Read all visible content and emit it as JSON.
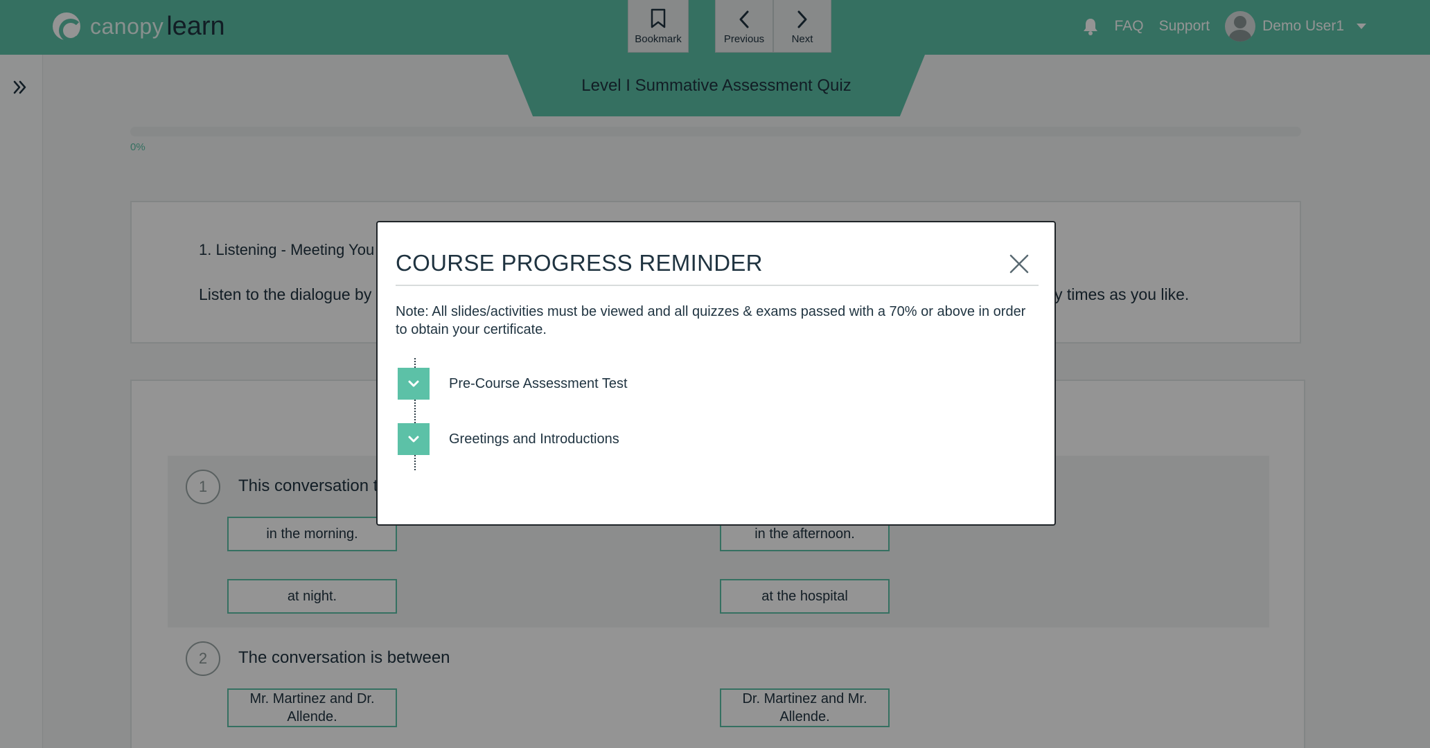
{
  "brand": {
    "word1": "canopy",
    "word2": "learn"
  },
  "toolbar": {
    "bookmark": "Bookmark",
    "previous": "Previous",
    "next": "Next"
  },
  "topnav": {
    "faq": "FAQ",
    "support": "Support",
    "user": "Demo User1"
  },
  "quiz": {
    "title": "Level I Summative Assessment Quiz",
    "progress_label": "0%",
    "progress": 0
  },
  "intro": {
    "title": "1. Listening - Meeting You",
    "text_left": "Listen to the dialogue by p",
    "text_right": "y times as you like."
  },
  "questions": [
    {
      "number": "1",
      "text": "This conversation ta",
      "options": [
        "in the morning.",
        "in the afternoon.",
        "at night.",
        "at the hospital"
      ]
    },
    {
      "number": "2",
      "text": "The conversation is between",
      "options": [
        "Mr. Martinez and Dr. Allende.",
        "Dr. Martinez and Mr. Allende."
      ]
    }
  ],
  "modal": {
    "title": "COURSE PROGRESS REMINDER",
    "note": "Note: All slides/activities must be viewed and all quizzes & exams passed with a 70% or above in order to obtain your certificate.",
    "items": [
      "Pre-Course Assessment Test",
      "Greetings and Introductions"
    ]
  },
  "colors": {
    "brand_green": "#5cc1a7",
    "text_dark": "#1f3340"
  }
}
